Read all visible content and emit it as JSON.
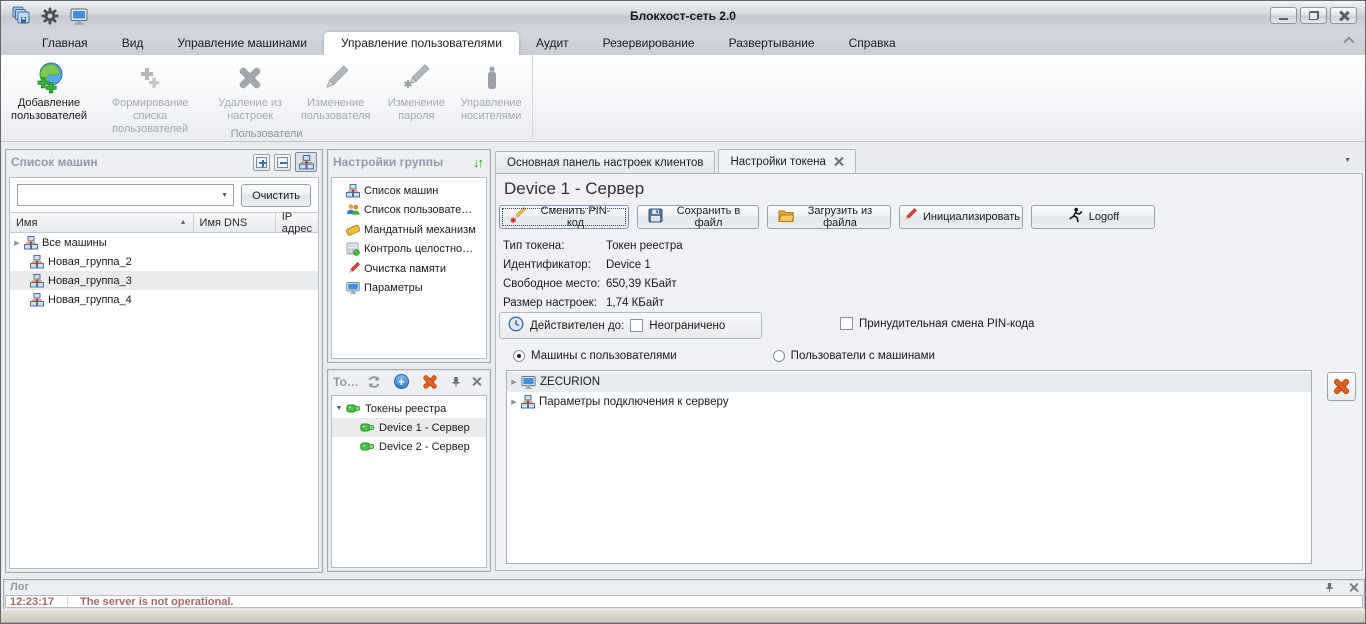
{
  "titlebar": {
    "title": "Блокхост-сеть 2.0"
  },
  "tabs": [
    "Главная",
    "Вид",
    "Управление машинами",
    "Управление пользователями",
    "Аудит",
    "Резервирование",
    "Развертывание",
    "Справка"
  ],
  "ribbon": {
    "group_label": "Пользователи",
    "buttons": [
      {
        "label": "Добавление пользователей",
        "enabled": true
      },
      {
        "label": "Формирование списка пользователей",
        "enabled": false
      },
      {
        "label": "Удаление из настроек",
        "enabled": false
      },
      {
        "label": "Изменение пользователя",
        "enabled": false
      },
      {
        "label": "Изменение пароля",
        "enabled": false
      },
      {
        "label": "Управление носителями",
        "enabled": false
      }
    ]
  },
  "machines_panel": {
    "title": "Список машин",
    "search_value": "",
    "clear_button": "Очистить",
    "columns": [
      "Имя",
      "Имя DNS",
      "IP адрес"
    ],
    "rows": [
      {
        "name": "Все машины",
        "expandable": true,
        "selected": false
      },
      {
        "name": "Новая_группа_2",
        "expandable": false,
        "selected": false
      },
      {
        "name": "Новая_группа_3",
        "expandable": false,
        "selected": true
      },
      {
        "name": "Новая_группа_4",
        "expandable": false,
        "selected": false
      }
    ]
  },
  "group_settings_panel": {
    "title": "Настройки группы",
    "items": [
      "Список машин",
      "Список пользовате…",
      "Мандатный механизм",
      "Контроль целостно…",
      "Очистка памяти",
      "Параметры"
    ]
  },
  "tokens_panel": {
    "title": "То…",
    "root": "Токены реестра",
    "children": [
      "Device 1 - Сервер",
      "Device 2 - Сервер"
    ],
    "selected_child": "Device 1 - Сервер"
  },
  "main": {
    "tabs": [
      {
        "label": "Основная панель настроек клиентов",
        "active": false
      },
      {
        "label": "Настройки токена",
        "active": true,
        "closable": true
      }
    ],
    "heading": "Device 1 - Сервер",
    "buttons": [
      "Сменить PIN-код",
      "Сохранить в файл",
      "Загрузить из файла",
      "Инициализировать",
      "Logoff"
    ],
    "info": [
      {
        "label": "Тип токена:",
        "value": "Токен реестра"
      },
      {
        "label": "Идентификатор:",
        "value": "Device 1"
      },
      {
        "label": "Свободное место:",
        "value": "650,39 КБайт"
      },
      {
        "label": "Размер настроек:",
        "value": "1,74 КБайт"
      }
    ],
    "valid_until": {
      "label": "Действителен до:",
      "checkbox_label": "Неограничено",
      "checked": false
    },
    "force_pin": {
      "label": "Принудительная смена PIN-кода",
      "checked": false
    },
    "radios": [
      {
        "label": "Машины с пользователями",
        "selected": true
      },
      {
        "label": "Пользователи с машинами",
        "selected": false
      }
    ],
    "tree": [
      {
        "label": "ZECURION",
        "selected": true
      },
      {
        "label": "Параметры подключения к серверу",
        "selected": false
      }
    ]
  },
  "log_panel": {
    "title": "Лог",
    "entries": [
      {
        "time": "12:23:17",
        "message": "The server is not operational."
      }
    ]
  },
  "icons": {
    "dropdown": "▼",
    "sort_asc": "▲",
    "tree_expand": "▶",
    "tree_collapse": "▼",
    "updown": "↓↑"
  },
  "colors": {
    "accent_green": "#17a817",
    "delete_orange": "#e2611f",
    "log_error_text": "#a56868",
    "panel_title_text": "#939bab"
  }
}
